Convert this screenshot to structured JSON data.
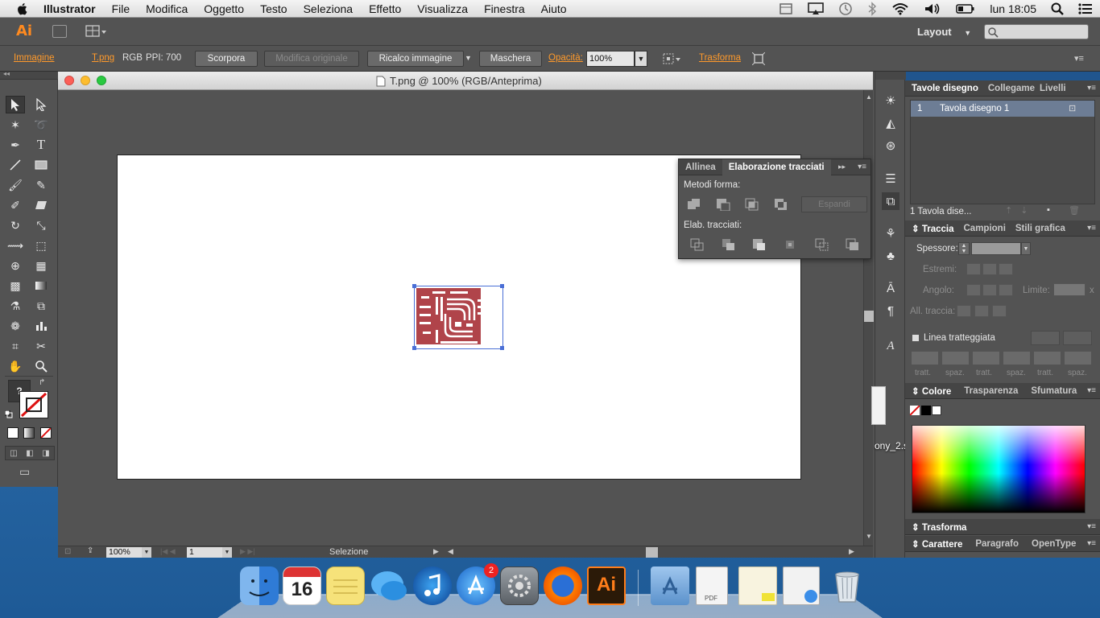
{
  "menubar": {
    "app_name": "Illustrator",
    "items": [
      "File",
      "Modifica",
      "Oggetto",
      "Testo",
      "Seleziona",
      "Effetto",
      "Visualizza",
      "Finestra",
      "Aiuto"
    ],
    "clock": "lun 18:05"
  },
  "appbar": {
    "logo": "Ai",
    "workspace_label": "Layout"
  },
  "control_bar": {
    "type_label": "Immagine",
    "file_link": "T.png",
    "color_mode": "RGB",
    "ppi": "PPI: 700",
    "embed_button": "Scorpora",
    "edit_original_button": "Modifica originale",
    "trace_button": "Ricalco immagine",
    "mask_button": "Maschera",
    "opacity_label": "Opacità:",
    "opacity_value": "100%",
    "transform_link": "Trasforma"
  },
  "document": {
    "title": "T.png @ 100% (RGB/Anteprima)",
    "zoom": "100%",
    "artboard_number": "1",
    "status_text": "Selezione"
  },
  "pathfinder_panel": {
    "tabs": [
      "Allinea",
      "Elaborazione tracciati"
    ],
    "shape_modes_label": "Metodi forma:",
    "expand_button": "Espandi",
    "pathfinders_label": "Elab. tracciati:"
  },
  "artboards_panel": {
    "tabs": [
      "Tavole disegno",
      "Collegame",
      "Livelli"
    ],
    "rows": [
      {
        "index": "1",
        "name": "Tavola disegno 1"
      }
    ],
    "footer": "1 Tavola dise..."
  },
  "stroke_panel": {
    "tabs": [
      "Traccia",
      "Campioni",
      "Stili grafica"
    ],
    "weight_label": "Spessore:",
    "caps_label": "Estremi:",
    "corner_label": "Angolo:",
    "limit_label": "Limite:",
    "align_label": "All. traccia:",
    "dashed_label": "Linea tratteggiata",
    "dash_labels": [
      "tratt.",
      "spaz.",
      "tratt.",
      "spaz.",
      "tratt.",
      "spaz."
    ],
    "limit_suffix": "x"
  },
  "color_panel": {
    "tabs": [
      "Colore",
      "Trasparenza",
      "Sfumatura"
    ]
  },
  "collapsed_panels": {
    "transform": "Trasforma",
    "character_tabs": [
      "Carattere",
      "Paragrafo",
      "OpenType"
    ]
  },
  "desktop": {
    "file_label": "ony_2.s"
  },
  "dock": {
    "calendar_day": "16",
    "appstore_badge": "2",
    "ai_label": "Ai",
    "pdf_label": "PDF"
  },
  "colors": {
    "accent_orange": "#ff9a2b",
    "ui_gray": "#535353",
    "artwork_red": "#b0444a",
    "selection_blue": "#4a6fd6"
  }
}
